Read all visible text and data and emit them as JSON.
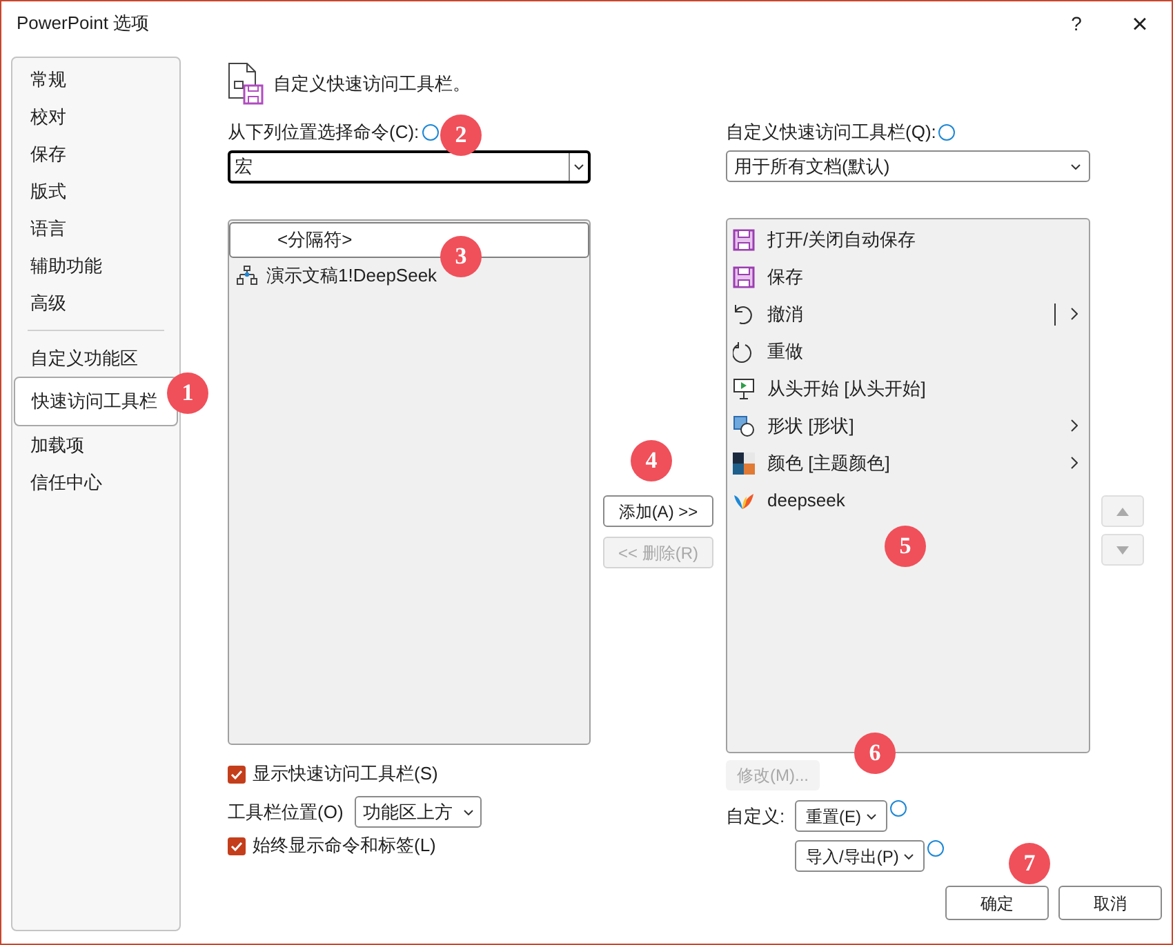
{
  "window": {
    "title": "PowerPoint 选项",
    "help": "?",
    "close": "×"
  },
  "sidebar": {
    "items": [
      {
        "kind": "item",
        "label": "常规",
        "selected": false
      },
      {
        "kind": "item",
        "label": "校对",
        "selected": false
      },
      {
        "kind": "item",
        "label": "保存",
        "selected": false
      },
      {
        "kind": "item",
        "label": "版式",
        "selected": false
      },
      {
        "kind": "item",
        "label": "语言",
        "selected": false
      },
      {
        "kind": "item",
        "label": "辅助功能",
        "selected": false
      },
      {
        "kind": "item",
        "label": "高级",
        "selected": false
      },
      {
        "kind": "separator"
      },
      {
        "kind": "item",
        "label": "自定义功能区",
        "selected": false
      },
      {
        "kind": "item",
        "label": "快速访问工具栏",
        "selected": true
      },
      {
        "kind": "item",
        "label": "加载项",
        "selected": false
      },
      {
        "kind": "item",
        "label": "信任中心",
        "selected": false
      }
    ]
  },
  "heading": "自定义快速访问工具栏。",
  "source": {
    "label": "从下列位置选择命令(C):",
    "value": "宏"
  },
  "commands": [
    {
      "label": "<分隔符>",
      "kind": "separator",
      "selected": true
    },
    {
      "label": "演示文稿1!DeepSeek",
      "kind": "macro",
      "selected": false
    }
  ],
  "add_button": {
    "label": "添加(A) >>",
    "disabled": false
  },
  "remove_button": {
    "label": "<< 删除(R)",
    "disabled": true
  },
  "target": {
    "label": "自定义快速访问工具栏(Q):",
    "value": "用于所有文档(默认)"
  },
  "toolbar_items": [
    {
      "label": "打开/关闭自动保存",
      "kind": "save",
      "submenu": false,
      "split": false
    },
    {
      "label": "保存",
      "kind": "save",
      "submenu": false,
      "split": false
    },
    {
      "label": "撤消",
      "kind": "undo",
      "submenu": true,
      "split": true
    },
    {
      "label": "重做",
      "kind": "redo",
      "submenu": false,
      "split": false
    },
    {
      "label": "从头开始 [从头开始]",
      "kind": "slideshow",
      "submenu": false,
      "split": false
    },
    {
      "label": "形状 [形状]",
      "kind": "shapes",
      "submenu": true,
      "split": false
    },
    {
      "label": "颜色 [主题颜色]",
      "kind": "colors",
      "submenu": true,
      "split": false
    },
    {
      "label": "deepseek",
      "kind": "bird",
      "submenu": false,
      "split": false
    }
  ],
  "move_up": {
    "disabled": true
  },
  "move_down": {
    "disabled": true
  },
  "show_toolbar": {
    "label": "显示快速访问工具栏(S)",
    "checked": true
  },
  "toolbar_position": {
    "label": "工具栏位置(O)",
    "value": "功能区上方"
  },
  "always_show_labels": {
    "label": "始终显示命令和标签(L)",
    "checked": true
  },
  "modify_button": {
    "label": "修改(M)...",
    "disabled": true
  },
  "customize": {
    "label": "自定义:",
    "reset": "重置(E)",
    "import_export": "导入/导出(P)"
  },
  "ok": "确定",
  "cancel": "取消",
  "markers": [
    {
      "label": "1"
    },
    {
      "label": "2"
    },
    {
      "label": "3"
    },
    {
      "label": "4"
    },
    {
      "label": "5"
    },
    {
      "label": "6"
    },
    {
      "label": "7"
    }
  ]
}
